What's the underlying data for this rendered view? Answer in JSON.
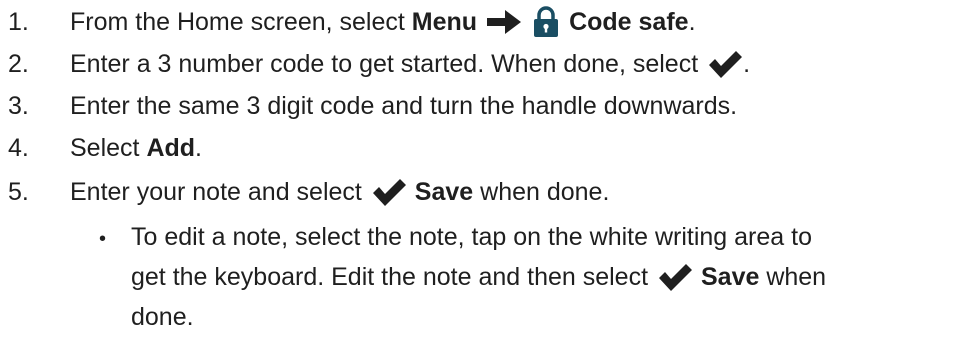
{
  "steps": [
    {
      "number": "1.",
      "pre": "From the Home screen, select ",
      "bold1": "Menu",
      "icon1": "arrow-right-icon",
      "icon2": "padlock-icon",
      "bold2": "Code safe",
      "post": "."
    },
    {
      "number": "2.",
      "pre": "Enter a 3 number code to get started. When done, select ",
      "icon": "checkmark-icon",
      "post": "."
    },
    {
      "number": "3.",
      "text": "Enter the same 3 digit code and turn the handle downwards."
    },
    {
      "number": "4.",
      "pre": "Select ",
      "bold": "Add",
      "post": "."
    },
    {
      "number": "5.",
      "pre": "Enter your note and select ",
      "icon": "checkmark-icon",
      "bold": "Save",
      "post": " when done."
    }
  ],
  "sub_bullet": {
    "marker": "•",
    "line1": "To edit a note, select the note, tap on the white writing area to",
    "line2_pre": "get the keyboard. Edit the note and then select ",
    "line2_icon": "checkmark-icon",
    "line2_bold": "Save",
    "line2_post": " when",
    "line3": "done."
  },
  "colors": {
    "text": "#1f1f1f",
    "icon": "#1f1f1f",
    "padlock_body": "#1a4e63"
  }
}
